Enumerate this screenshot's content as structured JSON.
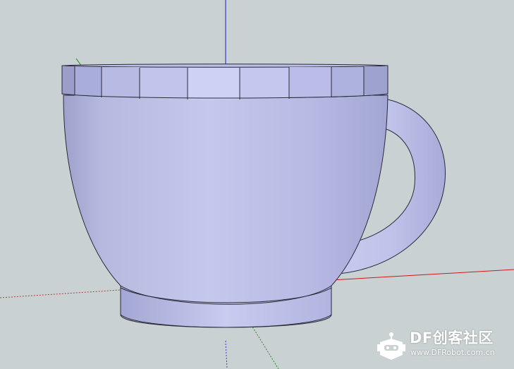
{
  "viewport": {
    "background": "#c9d1d3",
    "model": "teacup",
    "axes": {
      "red_axis_color": "#d01818",
      "green_axis_color": "#1a8a1a",
      "blue_axis_color": "#1a1adc"
    },
    "model_color": "#b9bde8"
  },
  "watermark": {
    "title": "DF创客社区",
    "url": "www.DFRobot.com.cn",
    "logo_icon": "robot-head-icon",
    "color": "#ffffff"
  }
}
